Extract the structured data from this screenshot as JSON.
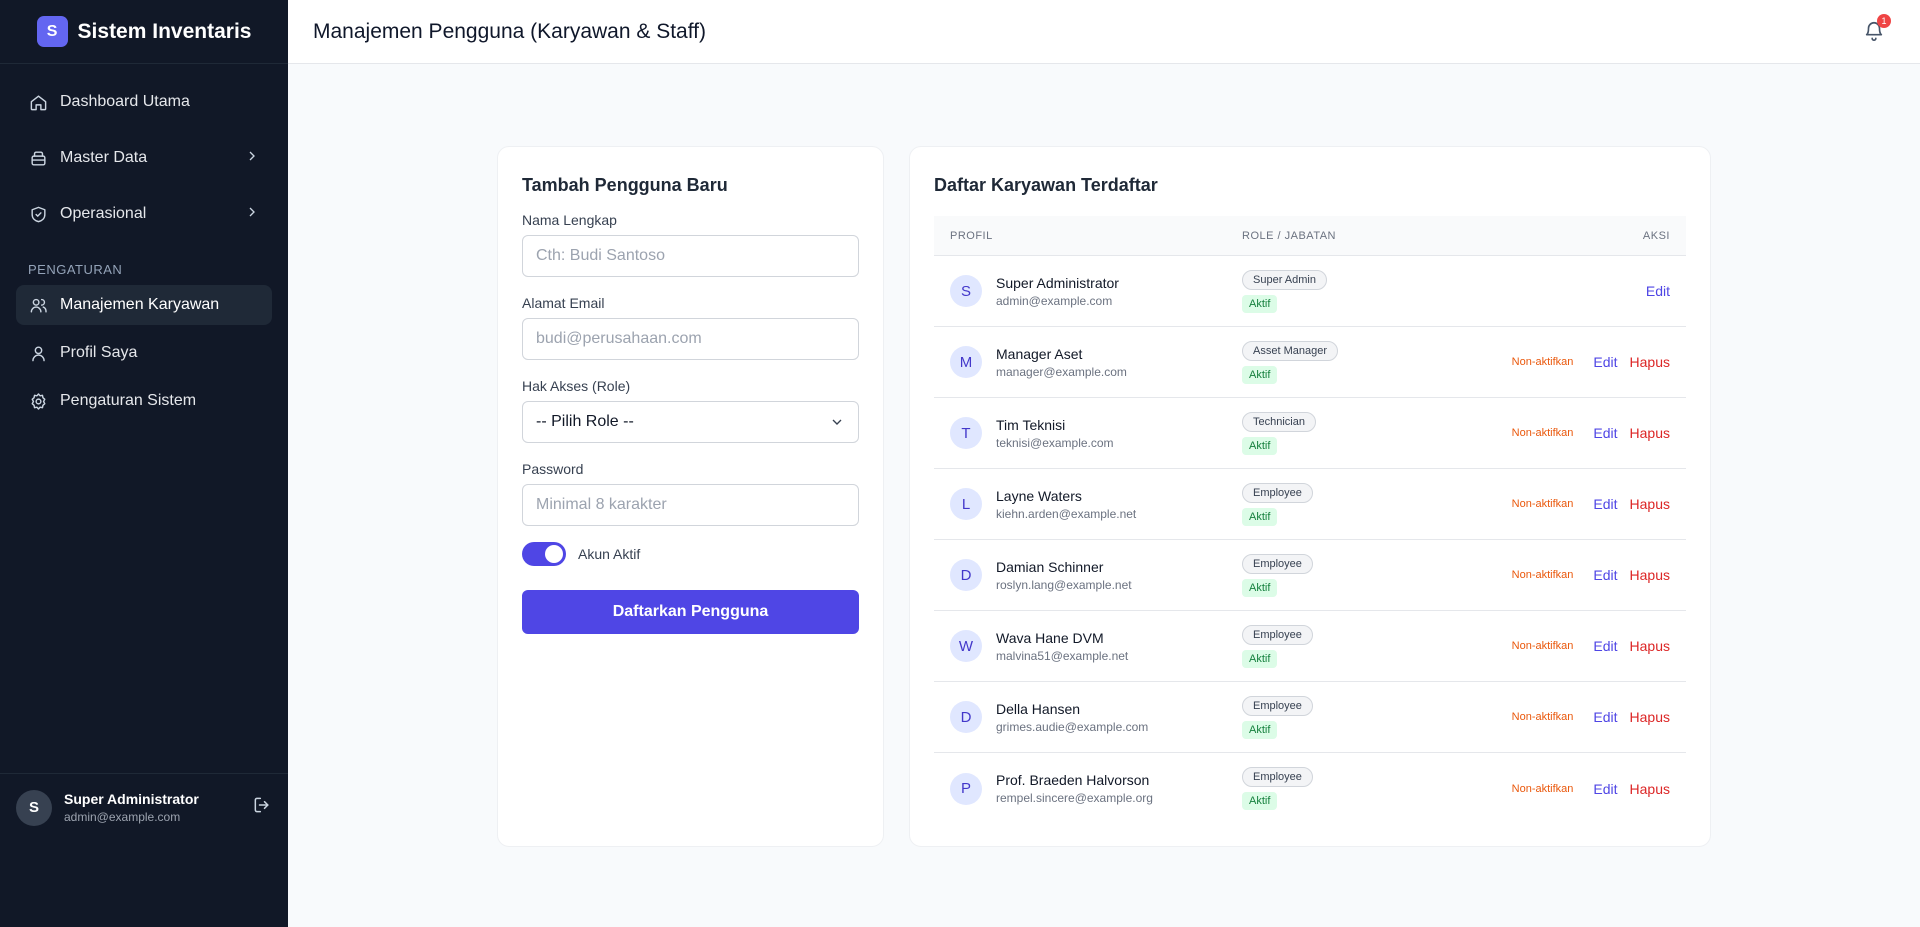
{
  "app": {
    "logo_letter": "S",
    "name": "Sistem Inventaris"
  },
  "sidebar": {
    "items": [
      {
        "label": "Dashboard Utama"
      },
      {
        "label": "Master Data"
      },
      {
        "label": "Operasional"
      }
    ],
    "section_label": "PENGATURAN",
    "settings_items": [
      {
        "label": "Manajemen Karyawan"
      },
      {
        "label": "Profil Saya"
      },
      {
        "label": "Pengaturan Sistem"
      }
    ],
    "user": {
      "initial": "S",
      "name": "Super Administrator",
      "email": "admin@example.com"
    }
  },
  "header": {
    "title": "Manajemen Pengguna (Karyawan & Staff)",
    "notification_count": "1"
  },
  "form": {
    "title": "Tambah Pengguna Baru",
    "name_label": "Nama Lengkap",
    "name_placeholder": "Cth: Budi Santoso",
    "email_label": "Alamat Email",
    "email_placeholder": "budi@perusahaan.com",
    "role_label": "Hak Akses (Role)",
    "role_selected": "-- Pilih Role --",
    "password_label": "Password",
    "password_placeholder": "Minimal 8 karakter",
    "active_label": "Akun Aktif",
    "submit_label": "Daftarkan Pengguna"
  },
  "list": {
    "title": "Daftar Karyawan Terdaftar",
    "columns": {
      "profile": "PROFIL",
      "role": "ROLE / JABATAN",
      "action": "AKSI"
    },
    "actions": {
      "deactivate": "Non-aktifkan",
      "edit": "Edit",
      "delete": "Hapus"
    },
    "rows": [
      {
        "initial": "S",
        "name": "Super Administrator",
        "email": "admin@example.com",
        "role": "Super Admin",
        "status": "Aktif"
      },
      {
        "initial": "M",
        "name": "Manager Aset",
        "email": "manager@example.com",
        "role": "Asset Manager",
        "status": "Aktif"
      },
      {
        "initial": "T",
        "name": "Tim Teknisi",
        "email": "teknisi@example.com",
        "role": "Technician",
        "status": "Aktif"
      },
      {
        "initial": "L",
        "name": "Layne Waters",
        "email": "kiehn.arden@example.net",
        "role": "Employee",
        "status": "Aktif"
      },
      {
        "initial": "D",
        "name": "Damian Schinner",
        "email": "roslyn.lang@example.net",
        "role": "Employee",
        "status": "Aktif"
      },
      {
        "initial": "W",
        "name": "Wava Hane DVM",
        "email": "malvina51@example.net",
        "role": "Employee",
        "status": "Aktif"
      },
      {
        "initial": "D",
        "name": "Della Hansen",
        "email": "grimes.audie@example.com",
        "role": "Employee",
        "status": "Aktif"
      },
      {
        "initial": "P",
        "name": "Prof. Braeden Halvorson",
        "email": "rempel.sincere@example.org",
        "role": "Employee",
        "status": "Aktif"
      }
    ]
  },
  "colors": {
    "accent": "#4f46e5",
    "sidebar_bg": "#111827",
    "danger": "#dc2626",
    "warning": "#ea580c",
    "success": "#15803d"
  }
}
